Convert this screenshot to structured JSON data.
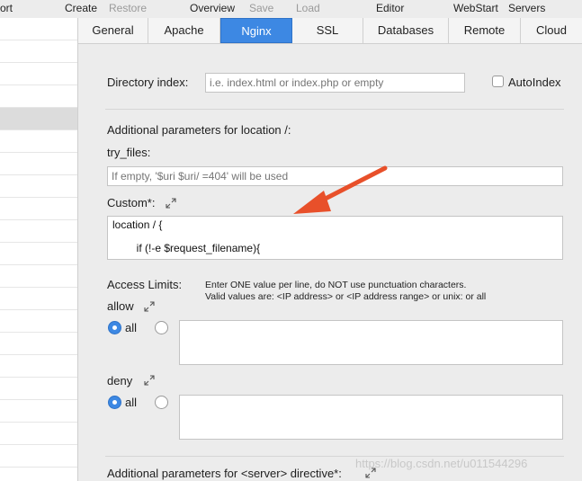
{
  "toolbar": {
    "port_partial": "ort",
    "create": "Create",
    "restore": "Restore",
    "overview": "Overview",
    "save": "Save",
    "load": "Load",
    "editor": "Editor",
    "webstart": "WebStart",
    "servers": "Servers"
  },
  "tabs": [
    "General",
    "Apache",
    "Nginx",
    "SSL",
    "Databases",
    "Remote",
    "Cloud"
  ],
  "active_tab": "Nginx",
  "directory_index": {
    "label": "Directory index:",
    "placeholder": "i.e. index.html or index.php or empty",
    "autoindex_label": "AutoIndex"
  },
  "location": {
    "heading": "Additional parameters for location /:",
    "try_files_label": "try_files:",
    "try_files_placeholder": "If empty, '$uri $uri/ =404' will be used",
    "custom_label": "Custom*:",
    "custom_line1": "location / {",
    "custom_line2": "        if (!-e $request_filename){"
  },
  "access": {
    "label": "Access Limits:",
    "hint1": "Enter ONE value per line, do NOT use punctuation characters.",
    "hint2": "Valid values are: <IP address> or <IP address range> or unix: or all",
    "allow_label": "allow",
    "deny_label": "deny",
    "all_label": "all"
  },
  "server": {
    "heading": "Additional parameters for <server> directive*:"
  },
  "watermark": "https://blog.csdn.net/u011544296",
  "colors": {
    "accent": "#3d88e3",
    "arrow": "#e8502a"
  }
}
